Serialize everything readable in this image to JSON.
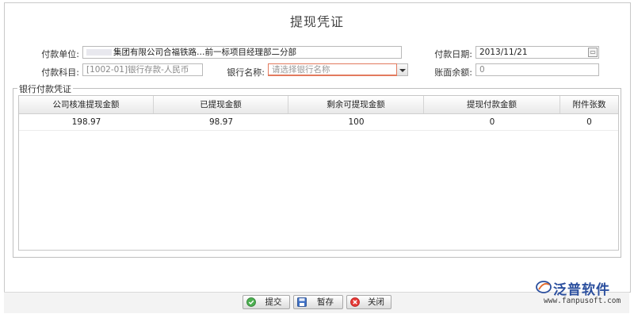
{
  "title": "提现凭证",
  "form": {
    "payer_label": "付款单位:",
    "payer_value": "集团有限公司合福铁路…前一标项目经理部二分部",
    "payment_date_label": "付款日期:",
    "payment_date_value": "2013/11/21",
    "account_label": "付款科目:",
    "account_value": "[1002-01]银行存款-人民币",
    "bank_label": "银行名称:",
    "bank_placeholder": "请选择银行名称",
    "balance_label": "账面余额:",
    "balance_value": "0"
  },
  "section": {
    "legend": "银行付款凭证"
  },
  "table": {
    "columns": [
      "公司核准提现金额",
      "已提现金额",
      "剩余可提现金额",
      "提现付款金额",
      "附件张数"
    ],
    "rows": [
      [
        "198.97",
        "98.97",
        "100",
        "0",
        "0"
      ]
    ]
  },
  "buttons": {
    "submit": "提交",
    "save_draft": "暂存",
    "close": "关闭"
  },
  "brand": {
    "name": "泛普软件",
    "url": "www.fanpusoft.com",
    "accent": "#2b4f9e"
  }
}
